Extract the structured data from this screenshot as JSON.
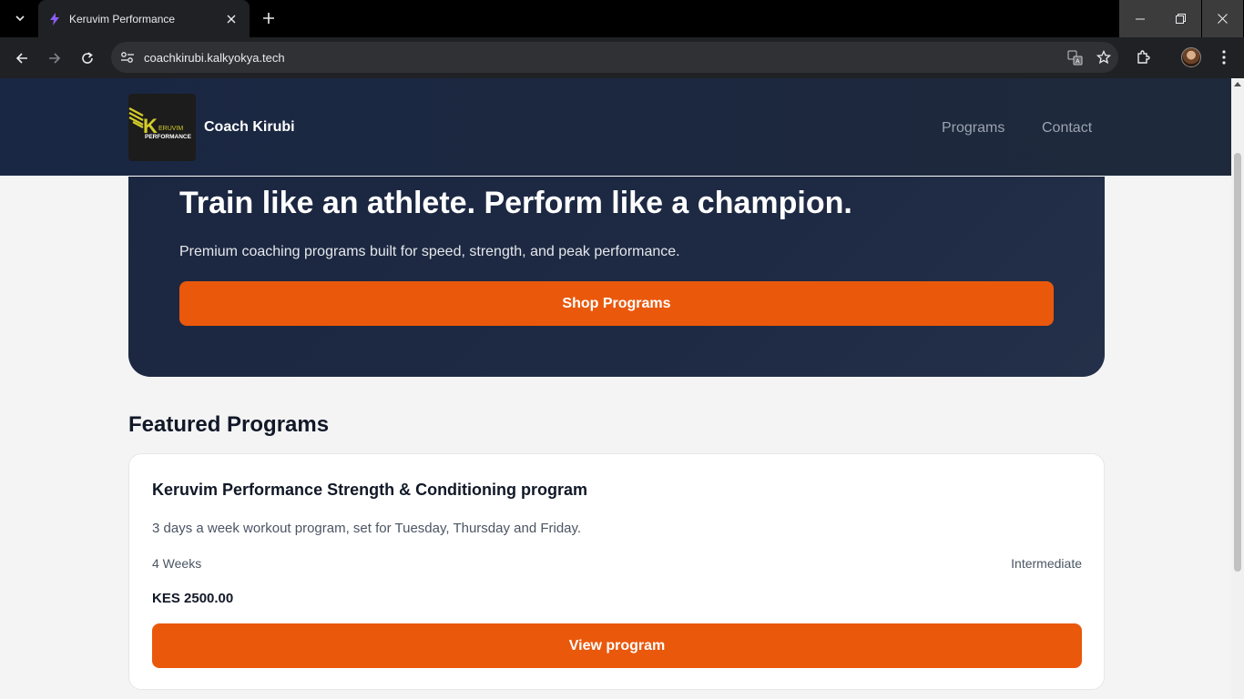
{
  "browser": {
    "tab_title": "Keruvim Performance",
    "url": "coachkirubi.kalkyokya.tech",
    "icons": [
      "tab-search-icon",
      "favicon-bolt-icon",
      "close-icon",
      "plus-icon",
      "minimize-icon",
      "restore-icon",
      "close-window-icon",
      "back-arrow-icon",
      "forward-arrow-icon",
      "reload-icon",
      "site-info-icon",
      "translate-icon",
      "star-icon",
      "extensions-icon",
      "avatar",
      "more-vert-icon"
    ]
  },
  "header": {
    "logo": {
      "alt_text": "KERUVIM PERFORMANCE",
      "letter": "K",
      "word1": "ERUVIM",
      "word2": "PERFORMANCE"
    },
    "brand": "Coach Kirubi",
    "nav": [
      {
        "label": "Programs"
      },
      {
        "label": "Contact"
      }
    ]
  },
  "hero": {
    "title": "Train like an athlete. Perform like a champion.",
    "subtitle": "Premium coaching programs built for speed, strength, and peak performance.",
    "cta": "Shop Programs"
  },
  "featured": {
    "title": "Featured Programs",
    "programs": [
      {
        "title": "Keruvim Performance Strength & Conditioning program",
        "description": "3 days a week workout program, set for Tuesday, Thursday and Friday.",
        "duration": "4 Weeks",
        "level": "Intermediate",
        "price": "KES 2500.00",
        "cta": "View program"
      }
    ]
  },
  "colors": {
    "accent": "#ea580c",
    "header_bg": "#1e293b",
    "hero_bg": "#1e2a44",
    "page_bg": "#f4f4f5",
    "logo_yellow": "#d4cc2a"
  }
}
